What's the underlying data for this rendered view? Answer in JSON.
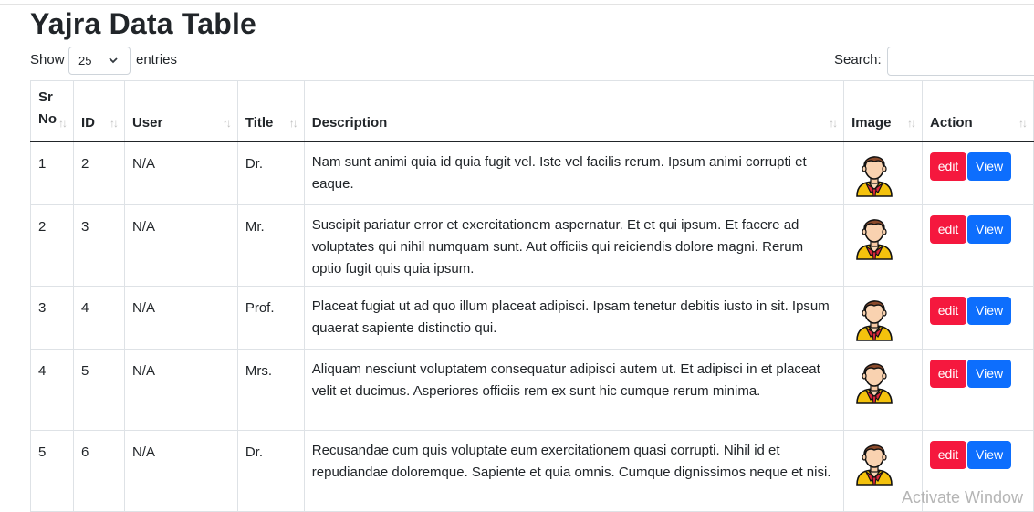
{
  "page": {
    "title": "Yajra Data Table"
  },
  "controls": {
    "show_label": "Show",
    "entries_value": "25",
    "entries_label": "entries",
    "search_label": "Search:",
    "search_value": ""
  },
  "table": {
    "headers": [
      "Sr No",
      "ID",
      "User",
      "Title",
      "Description",
      "Image",
      "Action"
    ],
    "rows": [
      {
        "sr": "1",
        "id": "2",
        "user": "N/A",
        "title": "Dr.",
        "description": "Nam sunt animi quia id quia fugit vel. Iste vel facilis rerum. Ipsum animi corrupti et eaque.",
        "image": "avatar-icon",
        "edit": "edit",
        "view": "View"
      },
      {
        "sr": "2",
        "id": "3",
        "user": "N/A",
        "title": "Mr.",
        "description": "Suscipit pariatur error et exercitationem aspernatur. Et et qui ipsum. Et facere ad voluptates qui nihil numquam sunt. Aut officiis qui reiciendis dolore magni. Rerum optio fugit quis quia ipsum.",
        "image": "avatar-icon",
        "edit": "edit",
        "view": "View"
      },
      {
        "sr": "3",
        "id": "4",
        "user": "N/A",
        "title": "Prof.",
        "description": "Placeat fugiat ut ad quo illum placeat adipisci. Ipsam tenetur debitis iusto in sit. Ipsum quaerat sapiente distinctio qui.",
        "image": "avatar-icon",
        "edit": "edit",
        "view": "View"
      },
      {
        "sr": "4",
        "id": "5",
        "user": "N/A",
        "title": "Mrs.",
        "description": "Aliquam nesciunt voluptatem consequatur adipisci autem ut. Et adipisci in et placeat velit et ducimus. Asperiores officiis rem ex sunt hic cumque rerum minima.",
        "image": "avatar-icon",
        "edit": "edit",
        "view": "View"
      },
      {
        "sr": "5",
        "id": "6",
        "user": "N/A",
        "title": "Dr.",
        "description": "Recusandae cum quis voluptate eum exercitationem quasi corrupti. Nihil id et repudiandae doloremque. Sapiente et quia omnis. Cumque dignissimos neque et nisi.",
        "image": "avatar-icon",
        "edit": "edit",
        "view": "View"
      }
    ]
  },
  "colors": {
    "edit_button": "#f5183e",
    "view_button": "#0d6efd"
  },
  "watermark": "Activate Window"
}
